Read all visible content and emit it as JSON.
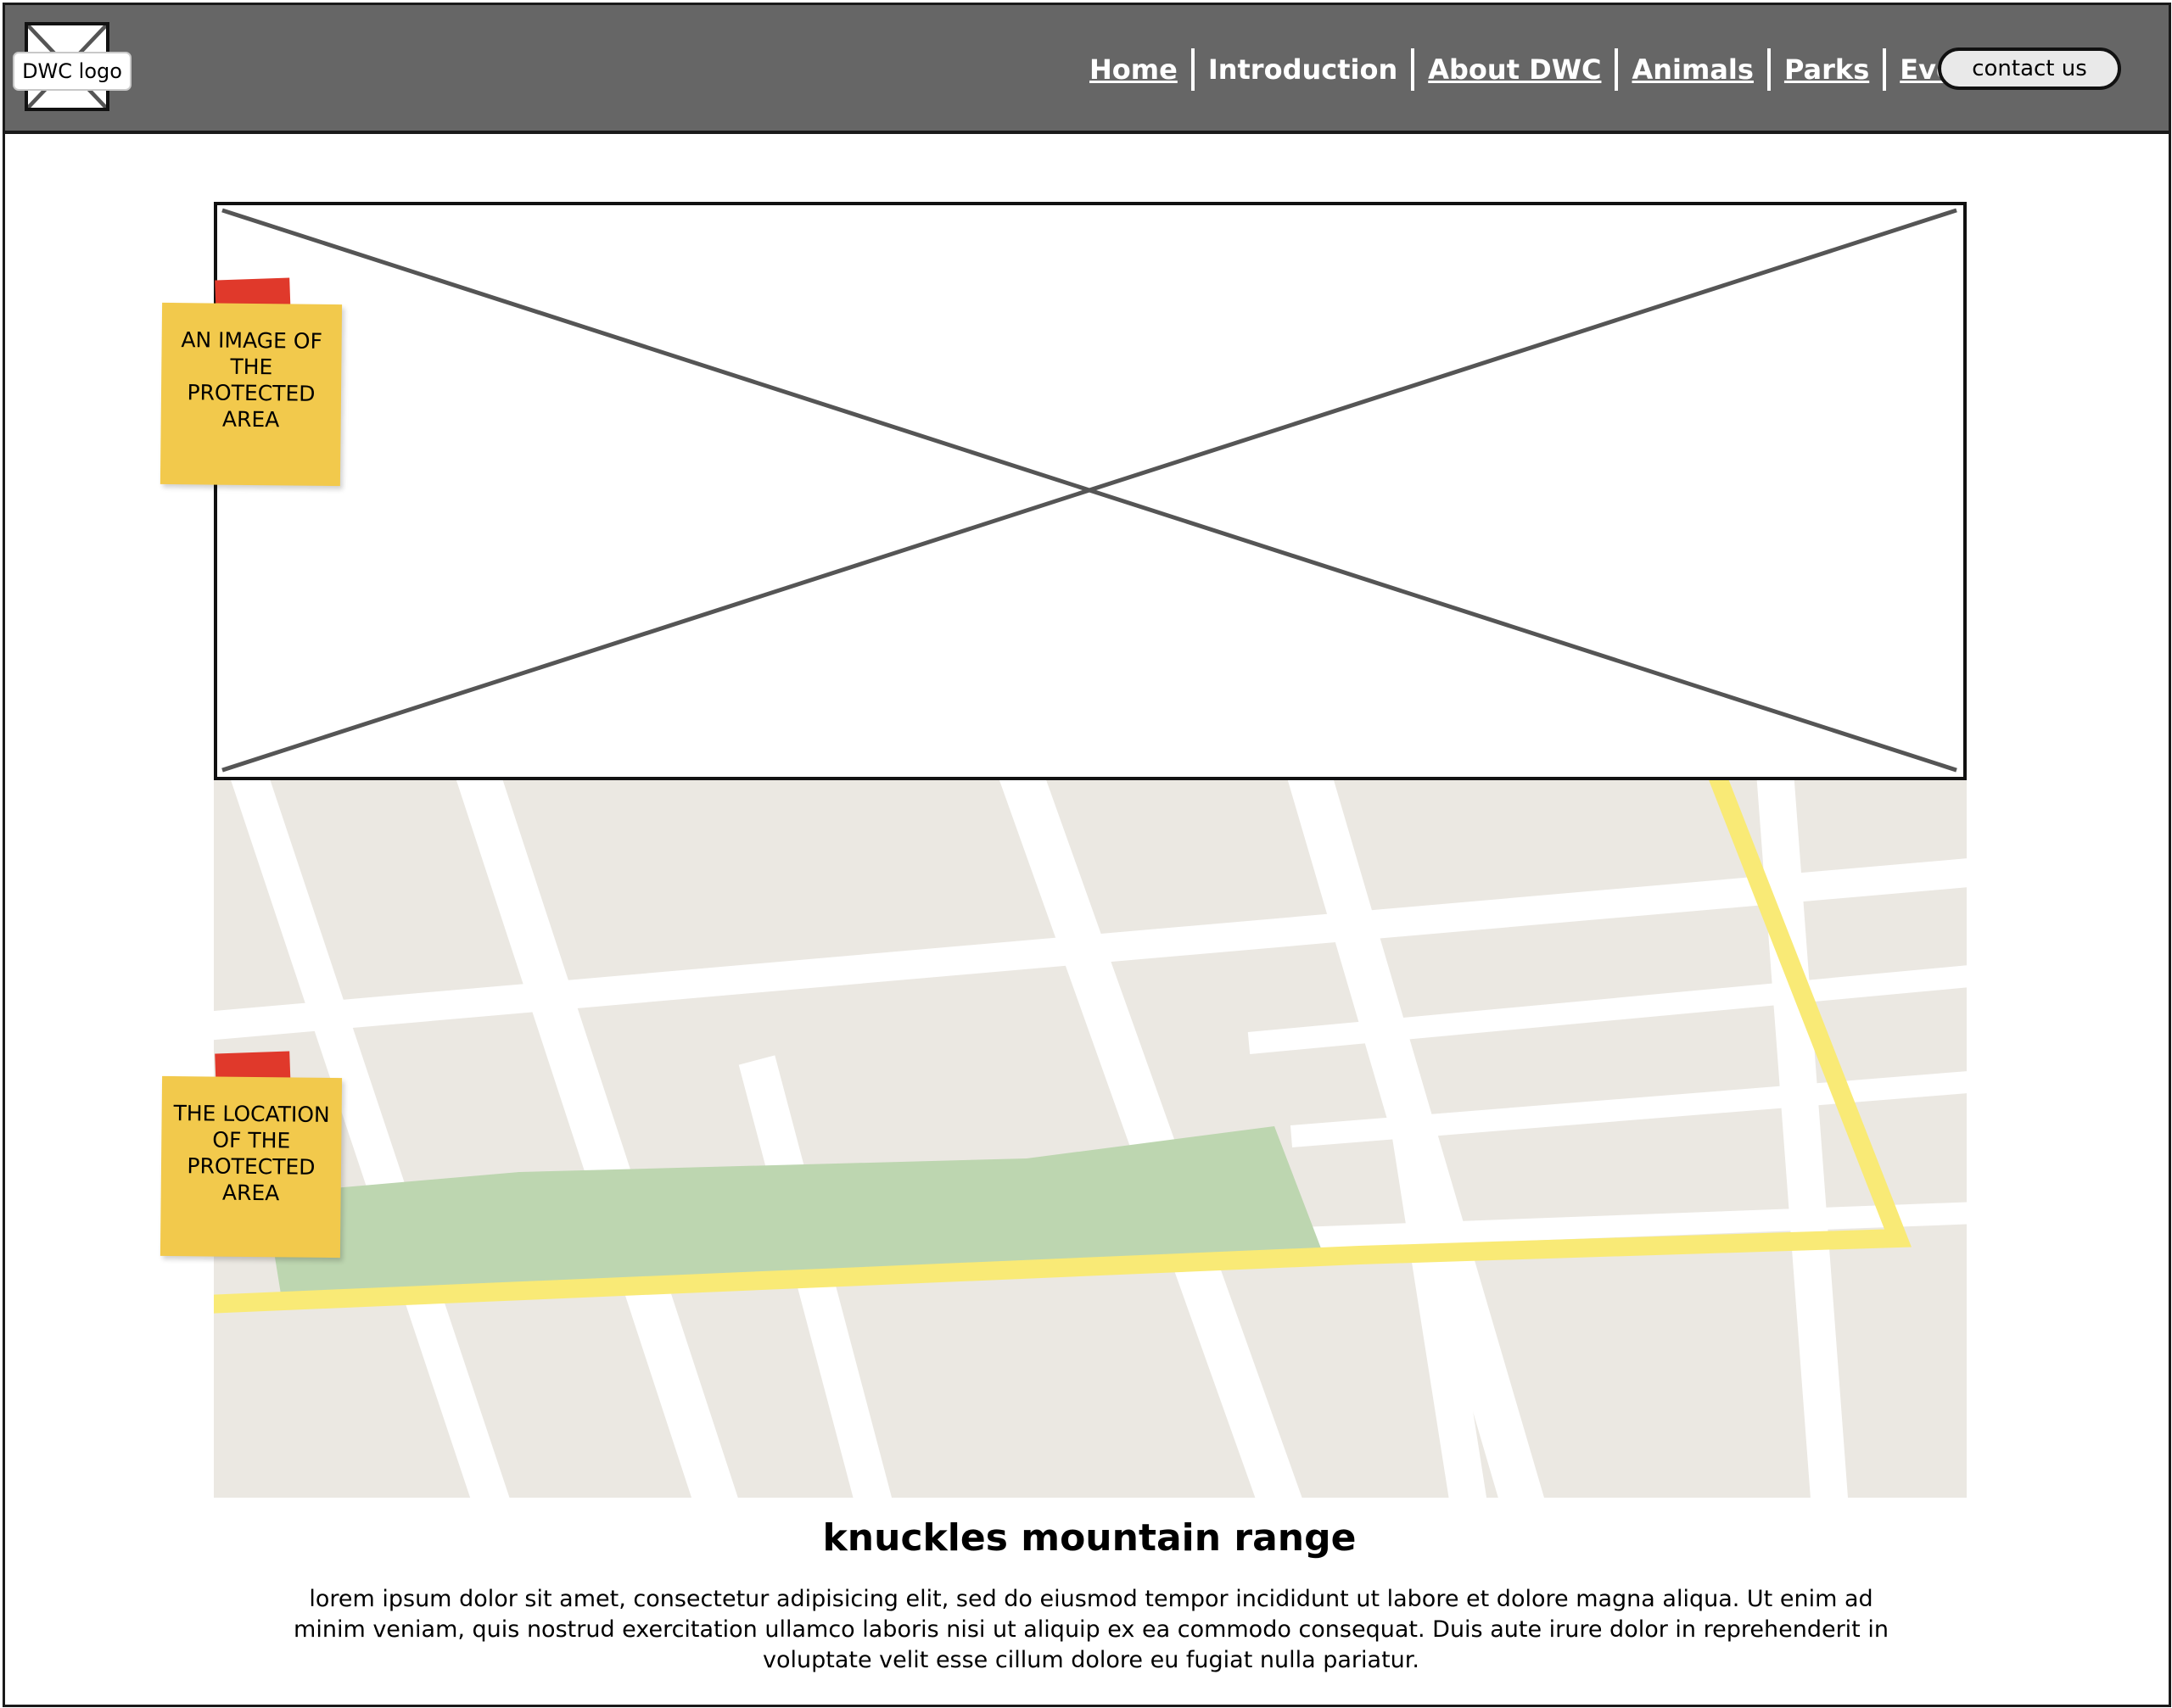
{
  "header": {
    "logo_text": "DWC logo",
    "nav": [
      {
        "label": "Home",
        "underlined": true
      },
      {
        "label": "Introduction",
        "underlined": false
      },
      {
        "label": "About DWC",
        "underlined": true
      },
      {
        "label": "Animals",
        "underlined": true
      },
      {
        "label": "Parks",
        "underlined": true
      },
      {
        "label": "Events",
        "underlined": true
      }
    ],
    "contact_label": "contact us"
  },
  "notes": {
    "image_note": "AN IMAGE OF THE PROTECTED AREA",
    "location_note": "THE LOCATION OF THE PROTECTED AREA"
  },
  "content": {
    "title": "knuckles mountain range",
    "body": "lorem ipsum dolor sit amet, consectetur adipisicing elit, sed do eiusmod tempor incididunt ut labore et dolore magna aliqua. Ut enim ad minim veniam, quis nostrud exercitation ullamco laboris nisi ut aliquip ex ea commodo consequat. Duis aute irure dolor in reprehenderit in voluptate velit esse cillum dolore eu fugiat nulla pariatur."
  },
  "colors": {
    "header_bg": "#666666",
    "map_block": "#ebe8e2",
    "map_road": "#ffffff",
    "map_route": "#f9ea76",
    "map_park": "#bdd6b0",
    "note": "#f2c94c",
    "tape": "#e0392b"
  }
}
